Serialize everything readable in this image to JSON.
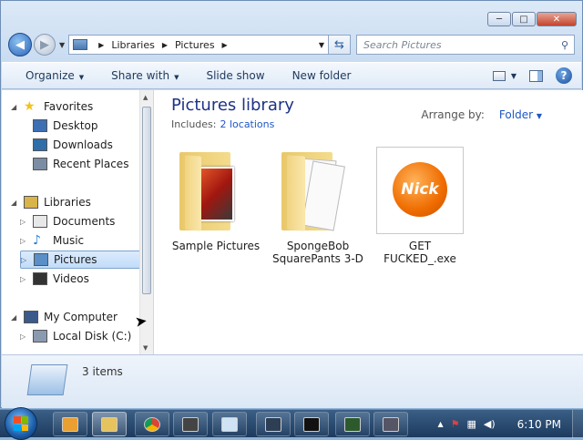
{
  "window": {
    "controls": {
      "minimize": "─",
      "maximize": "□",
      "close": "✕"
    }
  },
  "address_bar": {
    "segments": [
      "Libraries",
      "Pictures"
    ],
    "search_placeholder": "Search Pictures"
  },
  "command_bar": {
    "items": [
      "Organize",
      "Share with",
      "Slide show",
      "New folder"
    ],
    "help": "?"
  },
  "nav_pane": {
    "items": [
      {
        "label": "Favorites",
        "icon": "star-icon",
        "level": 0,
        "expander": "◢"
      },
      {
        "label": "Desktop",
        "icon": "desktop-icon",
        "level": 1,
        "expander": ""
      },
      {
        "label": "Downloads",
        "icon": "downloads-icon",
        "level": 1,
        "expander": ""
      },
      {
        "label": "Recent Places",
        "icon": "recent-places-icon",
        "level": 1,
        "expander": ""
      },
      {
        "label": "Libraries",
        "icon": "libraries-icon",
        "level": 0,
        "expander": "◢"
      },
      {
        "label": "Documents",
        "icon": "documents-icon",
        "level": 1,
        "expander": "▷"
      },
      {
        "label": "Music",
        "icon": "music-icon",
        "level": 1,
        "expander": "▷"
      },
      {
        "label": "Pictures",
        "icon": "pictures-icon",
        "level": 1,
        "expander": "▷",
        "selected": true
      },
      {
        "label": "Videos",
        "icon": "videos-icon",
        "level": 1,
        "expander": "▷"
      },
      {
        "label": "My Computer",
        "icon": "computer-icon",
        "level": 0,
        "expander": "◢"
      },
      {
        "label": "Local Disk (C:)",
        "icon": "disk-icon",
        "level": 1,
        "expander": "▷"
      }
    ]
  },
  "library": {
    "title": "Pictures library",
    "includes_label": "Includes:",
    "includes_link": "2 locations",
    "arrange_label": "Arrange by:",
    "arrange_value": "Folder"
  },
  "files": [
    {
      "name": "Sample Pictures",
      "type": "folder-with-picture"
    },
    {
      "name": "SpongeBob SquarePants 3-D",
      "type": "folder-with-documents"
    },
    {
      "name": "GET FUCKED_.exe",
      "type": "exe-nick-logo",
      "logo_text": "Nick"
    }
  ],
  "details": {
    "count": "3 items"
  },
  "taskbar": {
    "time": "6:10 PM",
    "buttons": [
      "media-player-icon",
      "explorer-icon",
      "chrome-icon",
      "7zip-icon",
      "notepad-icon",
      "settings-icon",
      "cmd-icon",
      "network-icon",
      "ar-icon"
    ]
  },
  "colors": {
    "title_blue": "#1e3287",
    "link_blue": "#1e57c8",
    "selection": "#c1dcf9"
  }
}
